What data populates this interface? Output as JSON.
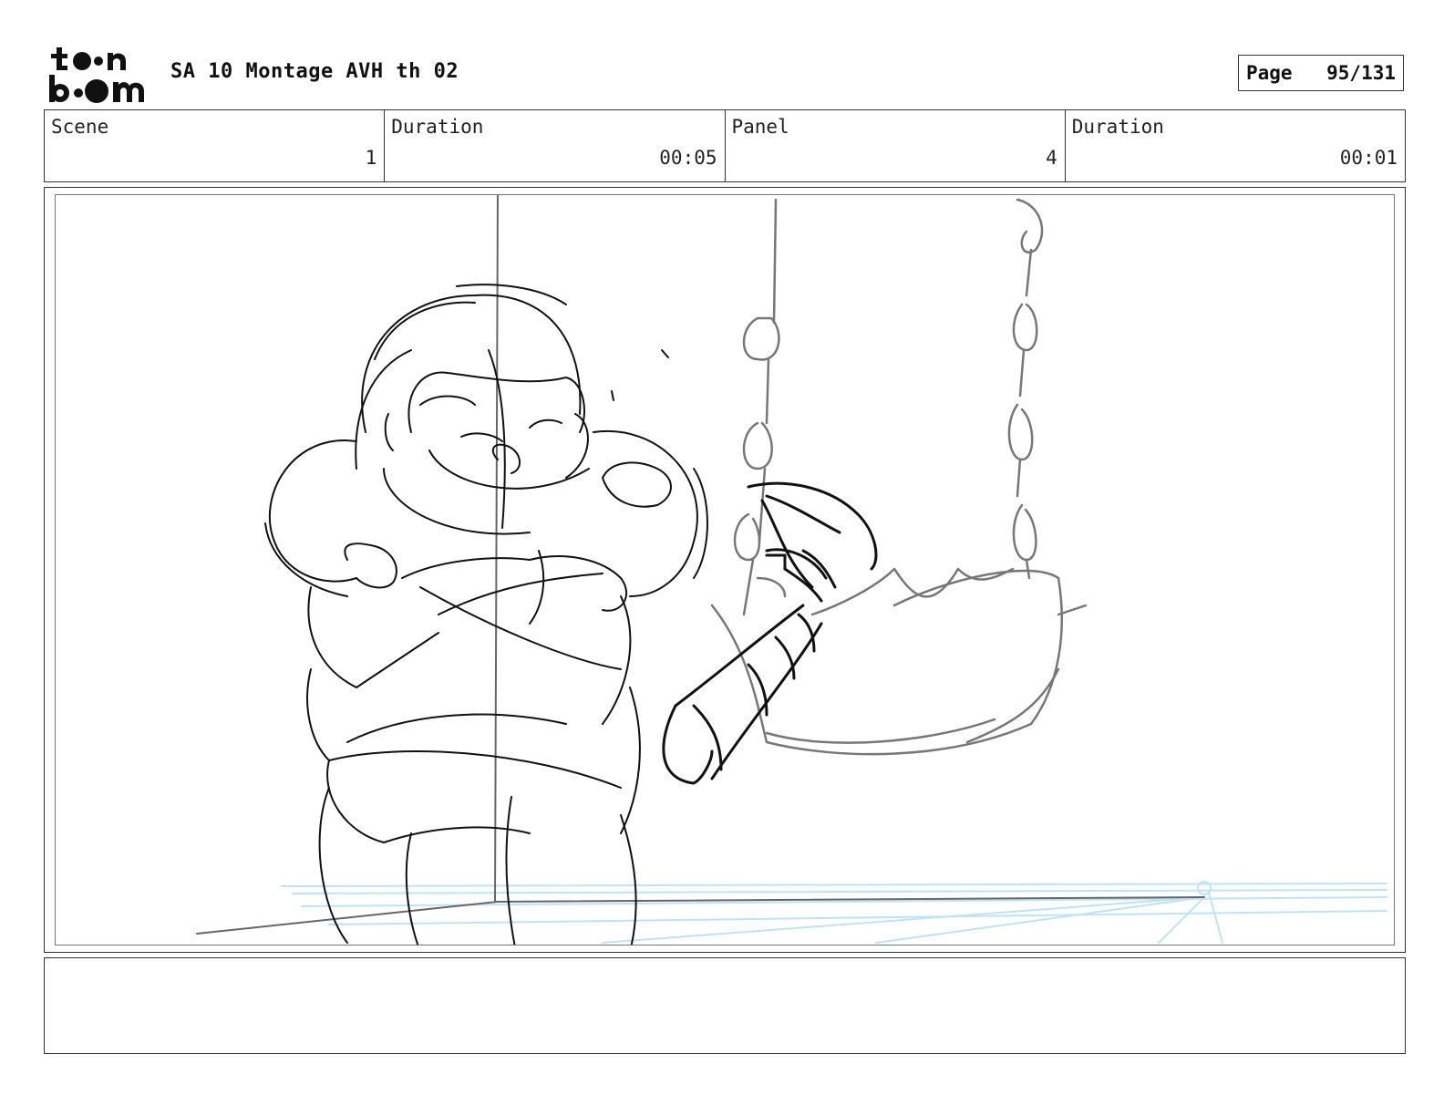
{
  "header": {
    "logo_text": "toon boom",
    "project_title": "SA 10 Montage AVH th 02",
    "page_label": "Page",
    "page_value": "95/131"
  },
  "info": {
    "scene_label": "Scene",
    "scene_value": "1",
    "scene_duration_label": "Duration",
    "scene_duration_value": "00:05",
    "panel_label": "Panel",
    "panel_value": "4",
    "panel_duration_label": "Duration",
    "panel_duration_value": "00:01"
  },
  "panel": {
    "description": "",
    "sketch_ink": "#111111",
    "sketch_gray": "#777777",
    "guide_blue": "#bfe3f5"
  },
  "caption": {
    "text": ""
  }
}
